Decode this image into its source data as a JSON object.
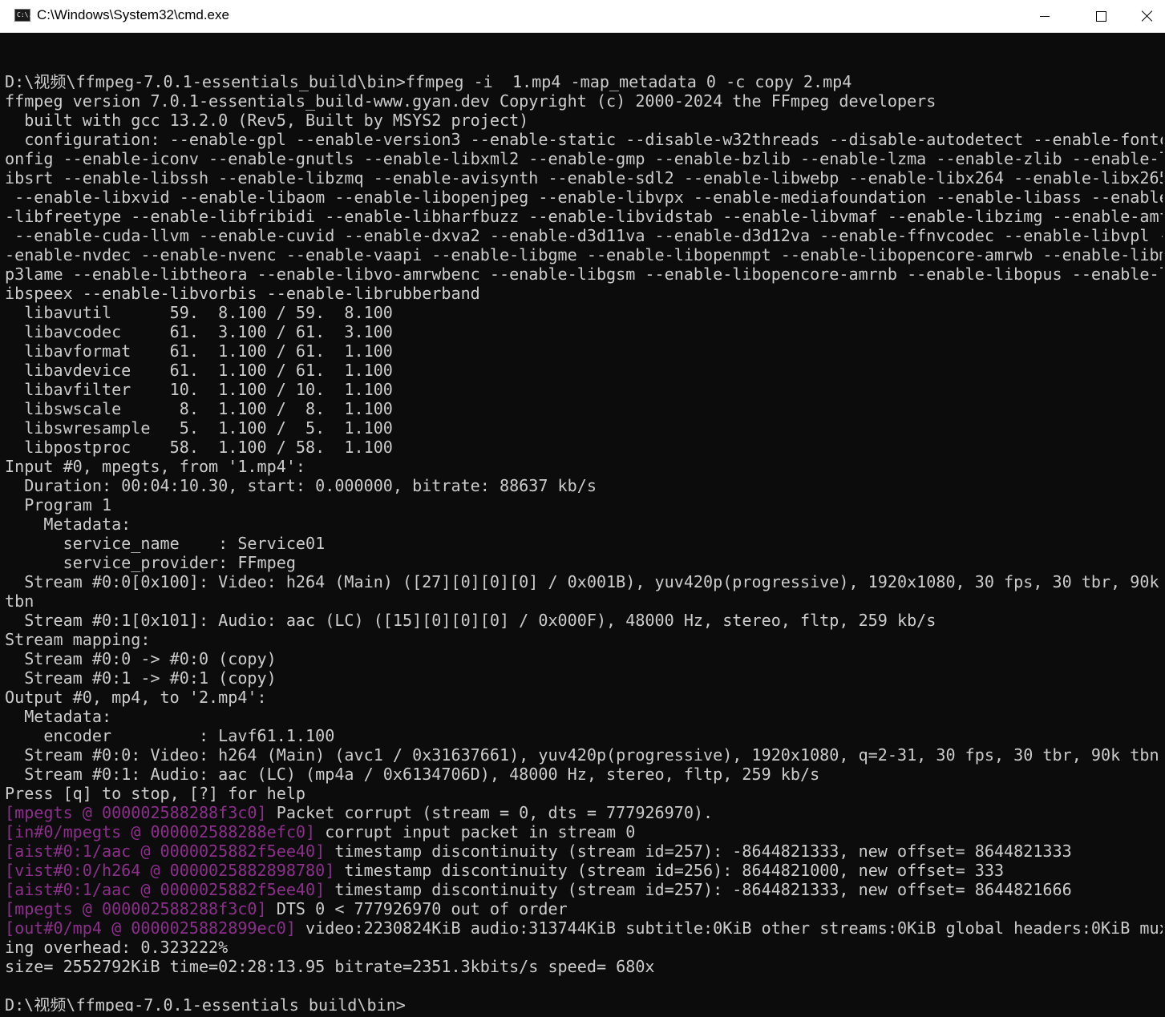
{
  "window": {
    "title": "C:\\Windows\\System32\\cmd.exe",
    "app_icon_text": "C:\\."
  },
  "console_lines": [
    {
      "text": ""
    },
    {
      "text": "D:\\视频\\ffmpeg-7.0.1-essentials_build\\bin>ffmpeg -i  1.mp4 -map_metadata 0 -c copy 2.mp4"
    },
    {
      "text": "ffmpeg version 7.0.1-essentials_build-www.gyan.dev Copyright (c) 2000-2024 the FFmpeg developers"
    },
    {
      "text": "  built with gcc 13.2.0 (Rev5, Built by MSYS2 project)"
    },
    {
      "text": "  configuration: --enable-gpl --enable-version3 --enable-static --disable-w32threads --disable-autodetect --enable-fontc"
    },
    {
      "text": "onfig --enable-iconv --enable-gnutls --enable-libxml2 --enable-gmp --enable-bzlib --enable-lzma --enable-zlib --enable-l"
    },
    {
      "text": "ibsrt --enable-libssh --enable-libzmq --enable-avisynth --enable-sdl2 --enable-libwebp --enable-libx264 --enable-libx265"
    },
    {
      "text": " --enable-libxvid --enable-libaom --enable-libopenjpeg --enable-libvpx --enable-mediafoundation --enable-libass --enable"
    },
    {
      "text": "-libfreetype --enable-libfribidi --enable-libharfbuzz --enable-libvidstab --enable-libvmaf --enable-libzimg --enable-amf"
    },
    {
      "text": " --enable-cuda-llvm --enable-cuvid --enable-dxva2 --enable-d3d11va --enable-d3d12va --enable-ffnvcodec --enable-libvpl -"
    },
    {
      "text": "-enable-nvdec --enable-nvenc --enable-vaapi --enable-libgme --enable-libopenmpt --enable-libopencore-amrwb --enable-libm"
    },
    {
      "text": "p3lame --enable-libtheora --enable-libvo-amrwbenc --enable-libgsm --enable-libopencore-amrnb --enable-libopus --enable-l"
    },
    {
      "text": "ibspeex --enable-libvorbis --enable-librubberband"
    },
    {
      "text": "  libavutil      59.  8.100 / 59.  8.100"
    },
    {
      "text": "  libavcodec     61.  3.100 / 61.  3.100"
    },
    {
      "text": "  libavformat    61.  1.100 / 61.  1.100"
    },
    {
      "text": "  libavdevice    61.  1.100 / 61.  1.100"
    },
    {
      "text": "  libavfilter    10.  1.100 / 10.  1.100"
    },
    {
      "text": "  libswscale      8.  1.100 /  8.  1.100"
    },
    {
      "text": "  libswresample   5.  1.100 /  5.  1.100"
    },
    {
      "text": "  libpostproc    58.  1.100 / 58.  1.100"
    },
    {
      "text": "Input #0, mpegts, from '1.mp4':"
    },
    {
      "text": "  Duration: 00:04:10.30, start: 0.000000, bitrate: 88637 kb/s"
    },
    {
      "text": "  Program 1"
    },
    {
      "text": "    Metadata:"
    },
    {
      "text": "      service_name    : Service01"
    },
    {
      "text": "      service_provider: FFmpeg"
    },
    {
      "text": "  Stream #0:0[0x100]: Video: h264 (Main) ([27][0][0][0] / 0x001B), yuv420p(progressive), 1920x1080, 30 fps, 30 tbr, 90k"
    },
    {
      "text": "tbn"
    },
    {
      "text": "  Stream #0:1[0x101]: Audio: aac (LC) ([15][0][0][0] / 0x000F), 48000 Hz, stereo, fltp, 259 kb/s"
    },
    {
      "text": "Stream mapping:"
    },
    {
      "text": "  Stream #0:0 -> #0:0 (copy)"
    },
    {
      "text": "  Stream #0:1 -> #0:1 (copy)"
    },
    {
      "text": "Output #0, mp4, to '2.mp4':"
    },
    {
      "text": "  Metadata:"
    },
    {
      "text": "    encoder         : Lavf61.1.100"
    },
    {
      "text": "  Stream #0:0: Video: h264 (Main) (avc1 / 0x31637661), yuv420p(progressive), 1920x1080, q=2-31, 30 fps, 30 tbr, 90k tbn"
    },
    {
      "text": "  Stream #0:1: Audio: aac (LC) (mp4a / 0x6134706D), 48000 Hz, stereo, fltp, 259 kb/s"
    },
    {
      "text": "Press [q] to stop, [?] for help"
    },
    {
      "tag": "[mpegts @ 000002588288f3c0]",
      "text": " Packet corrupt (stream = 0, dts = 777926970)."
    },
    {
      "tag": "[in#0/mpegts @ 000002588288efc0]",
      "text": " corrupt input packet in stream 0"
    },
    {
      "tag": "[aist#0:1/aac @ 0000025882f5ee40]",
      "text": " timestamp discontinuity (stream id=257): -8644821333, new offset= 8644821333"
    },
    {
      "tag": "[vist#0:0/h264 @ 0000025882898780]",
      "text": " timestamp discontinuity (stream id=256): 8644821000, new offset= 333"
    },
    {
      "tag": "[aist#0:1/aac @ 0000025882f5ee40]",
      "text": " timestamp discontinuity (stream id=257): -8644821333, new offset= 8644821666"
    },
    {
      "tag": "[mpegts @ 000002588288f3c0]",
      "text": " DTS 0 < 777926970 out of order"
    },
    {
      "tag": "[out#0/mp4 @ 0000025882899ec0]",
      "text": " video:2230824KiB audio:313744KiB subtitle:0KiB other streams:0KiB global headers:0KiB mux"
    },
    {
      "text": "ing overhead: 0.323222%"
    },
    {
      "text": "size= 2552792KiB time=02:28:13.95 bitrate=2351.3kbits/s speed= 680x"
    },
    {
      "text": ""
    },
    {
      "text": "D:\\视频\\ffmpeg-7.0.1-essentials_build\\bin>"
    }
  ],
  "colors": {
    "background": "#0c0c0c",
    "text": "#cccccc",
    "log_tag": "#8b2f8b",
    "titlebar": "#ffffff"
  },
  "icons": [
    "cmd-app-icon",
    "minimize-icon",
    "maximize-icon",
    "close-icon"
  ]
}
